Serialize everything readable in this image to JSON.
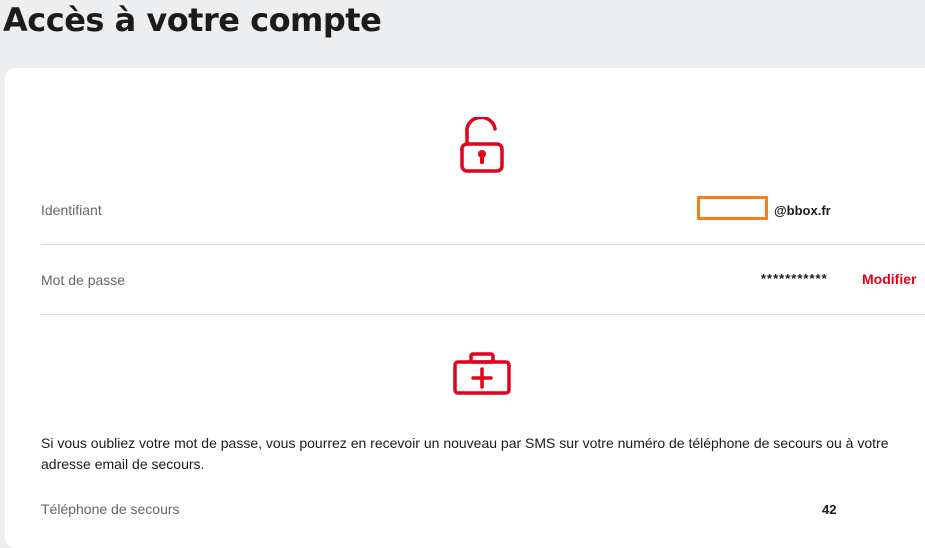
{
  "page": {
    "title": "Accès à votre compte"
  },
  "account": {
    "identifier_label": "Identifiant",
    "identifier_value": "@bbox.fr",
    "password_label": "Mot de passe",
    "password_value": "***********",
    "modify_label": "Modifier"
  },
  "recovery": {
    "description": "Si vous oubliez votre mot de passe, vous pourrez en recevoir un nouveau par SMS sur votre numéro de téléphone de secours ou à votre adresse email de secours.",
    "phone_label": "Téléphone de secours",
    "phone_value": "42"
  },
  "colors": {
    "accent": "#e2001a",
    "highlight": "#f28022"
  },
  "icons": {
    "lock": "lock-open-icon",
    "kit": "first-aid-kit-icon"
  }
}
